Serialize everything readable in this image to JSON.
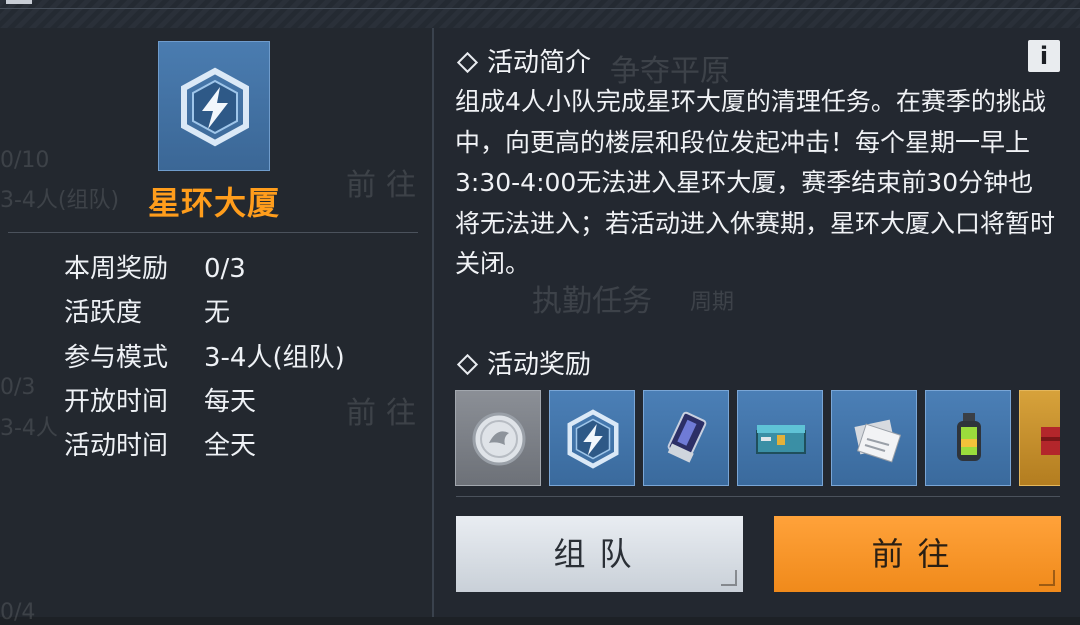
{
  "event": {
    "title": "星环大厦",
    "icon": "lightning-hexagon-icon"
  },
  "stats": [
    {
      "label": "本周奖励",
      "value": "0/3"
    },
    {
      "label": "活跃度",
      "value": "无"
    },
    {
      "label": "参与模式",
      "value": "3-4人(组队)"
    },
    {
      "label": "开放时间",
      "value": "每天"
    },
    {
      "label": "活动时间",
      "value": "全天"
    }
  ],
  "intro": {
    "heading": "活动简介",
    "info_label": "i",
    "text": "组成4人小队完成星环大厦的清理任务。在赛季的挑战中，向更高的楼层和段位发起冲击！每个星期一早上3:30-4:00无法进入星环大厦，赛季结束前30分钟也将无法进入；若活动进入休赛期，星环大厦入口将暂时关闭。"
  },
  "rewards": {
    "heading": "活动奖励",
    "items": [
      {
        "icon": "silver-coin-icon",
        "rarity": "gray"
      },
      {
        "icon": "lightning-hexagon-icon",
        "rarity": "blue"
      },
      {
        "icon": "keycard-icon",
        "rarity": "blue"
      },
      {
        "icon": "supply-crate-icon",
        "rarity": "blue"
      },
      {
        "icon": "blueprint-papers-icon",
        "rarity": "blue"
      },
      {
        "icon": "grenade-canister-icon",
        "rarity": "blue"
      },
      {
        "icon": "red-case-icon",
        "rarity": "gold"
      }
    ]
  },
  "buttons": {
    "team": "组队",
    "go": "前往"
  },
  "background_ghost": {
    "frac1": "0/10",
    "mode1": "3-4人(组队)",
    "go1": "前往",
    "frac2": "0/3",
    "mode2": "3-4人",
    "go2": "前往",
    "title1": "争夺平原",
    "title2": "执勤任务",
    "tag": "周期",
    "frac3": "0/4"
  },
  "colors": {
    "accent_orange": "#ff9d1c",
    "go_button": "#f08a1b",
    "panel_bg": "#23282f",
    "reward_blue": "#3a6a9d"
  }
}
